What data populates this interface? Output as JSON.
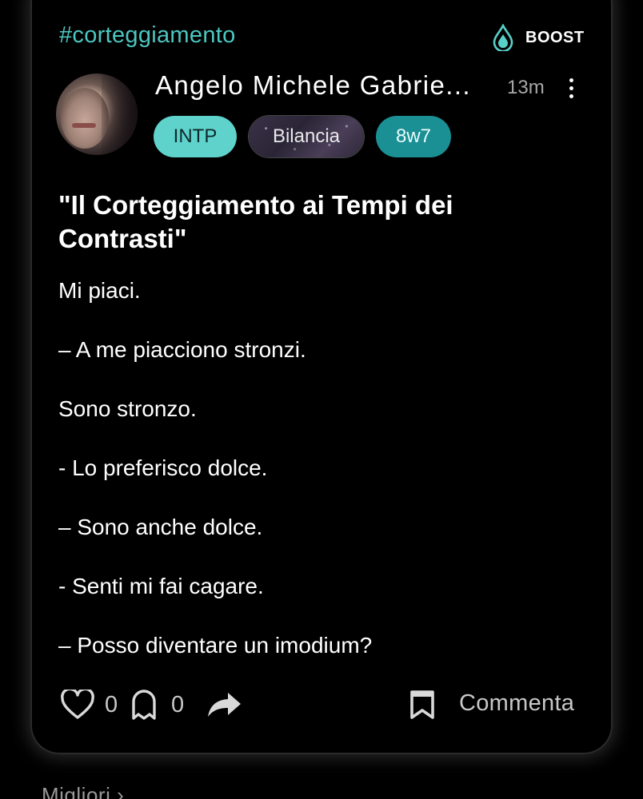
{
  "post": {
    "hashtag": "#corteggiamento",
    "boost_label": "BOOST",
    "author_name": "Angelo Michele Gabrie...",
    "time_ago": "13m",
    "tags": {
      "personality": "INTP",
      "zodiac": "Bilancia",
      "enneagram": "8w7"
    },
    "title": "\"Il Corteggiamento ai Tempi dei Contrasti\"",
    "body_lines": [
      "Mi piaci.",
      "– A me piacciono stronzi.",
      "Sono stronzo.",
      "- Lo preferisco dolce.",
      "– Sono anche dolce.",
      "- Senti mi fai cagare.",
      "– Posso diventare un imodium?"
    ],
    "likes_count": "0",
    "ghost_count": "0",
    "comment_label": "Commenta"
  },
  "footer": {
    "best_label": "Migliori ›"
  },
  "icons": {
    "boost": "water-drop-icon",
    "more": "more-vertical-icon",
    "like": "heart-icon",
    "ghost": "ghost-icon",
    "share": "share-arrow-icon",
    "save": "bookmark-icon"
  },
  "colors": {
    "accent": "#4cc7c0",
    "intp_pill": "#5fd2cc",
    "enneagram_pill": "#1a8f94",
    "background": "#000000"
  }
}
